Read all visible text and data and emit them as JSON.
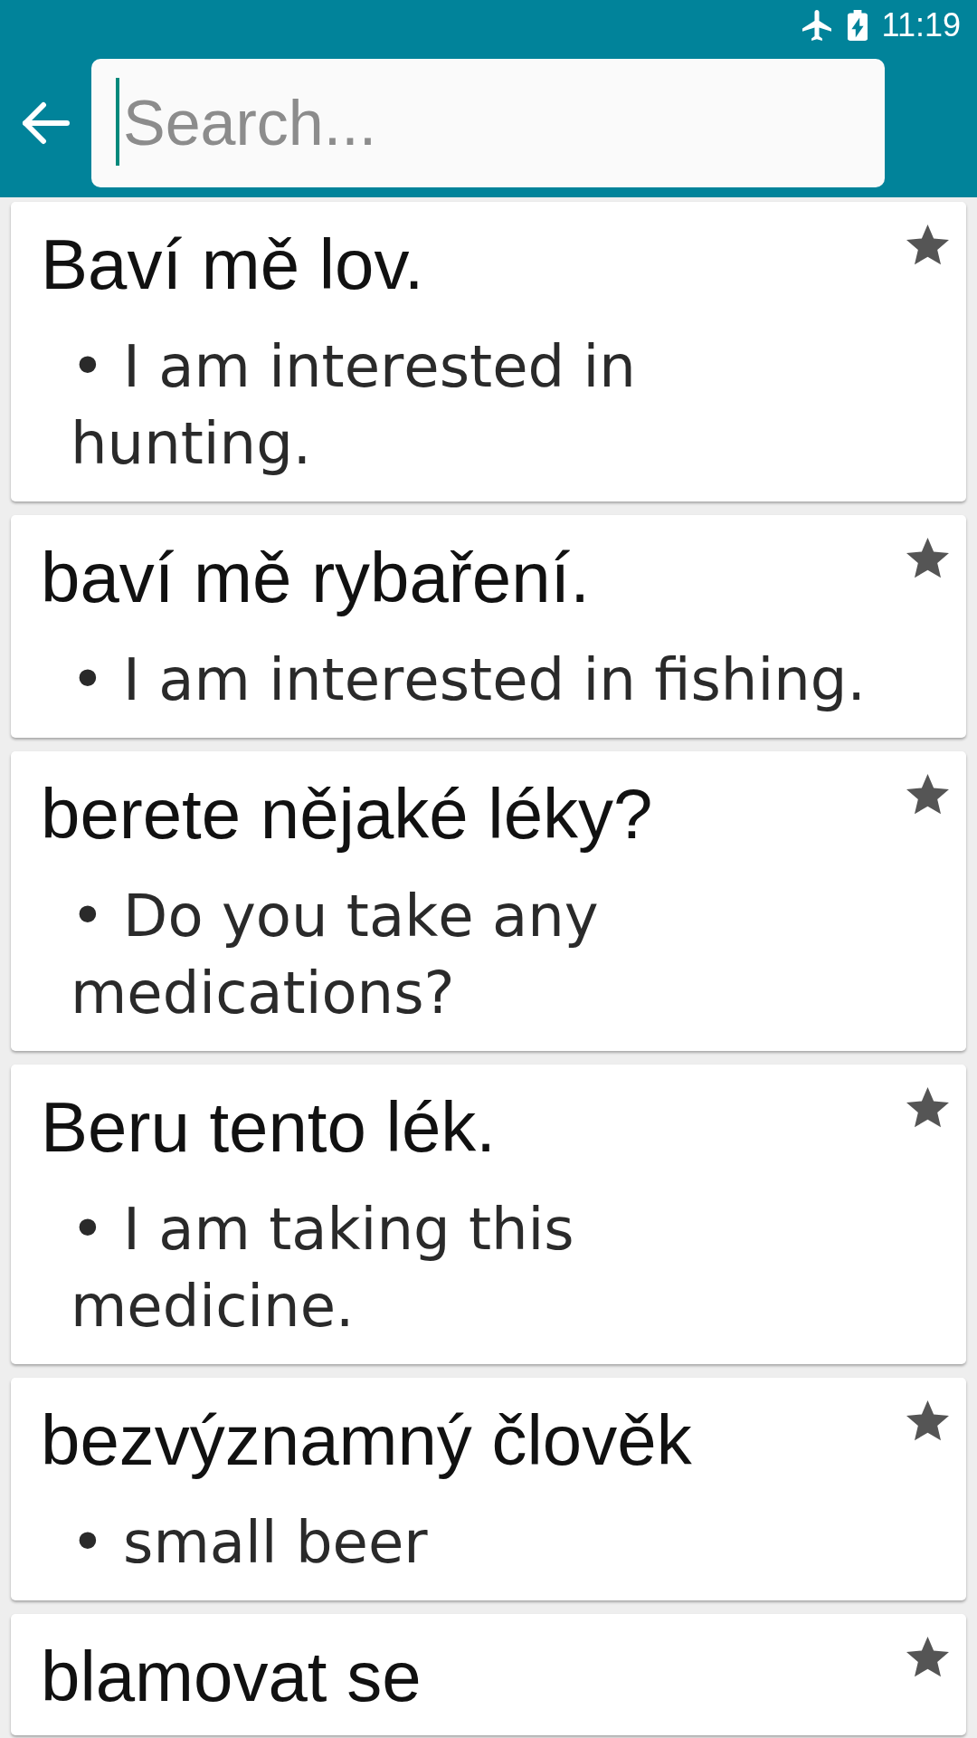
{
  "status_bar": {
    "time": "11:19"
  },
  "search": {
    "placeholder": "Search..."
  },
  "entries": [
    {
      "term": "Baví mě lov.",
      "translation": "• I am interested in hunting."
    },
    {
      "term": "baví mě rybaření.",
      "translation": "• I am interested in fishing."
    },
    {
      "term": "berete nějaké léky?",
      "translation": "• Do you take any medications?"
    },
    {
      "term": "Beru tento lék.",
      "translation": "• I am taking this medicine."
    },
    {
      "term": "bezvýznamný člověk",
      "translation": "• small beer"
    },
    {
      "term": "blamovat se"
    }
  ]
}
